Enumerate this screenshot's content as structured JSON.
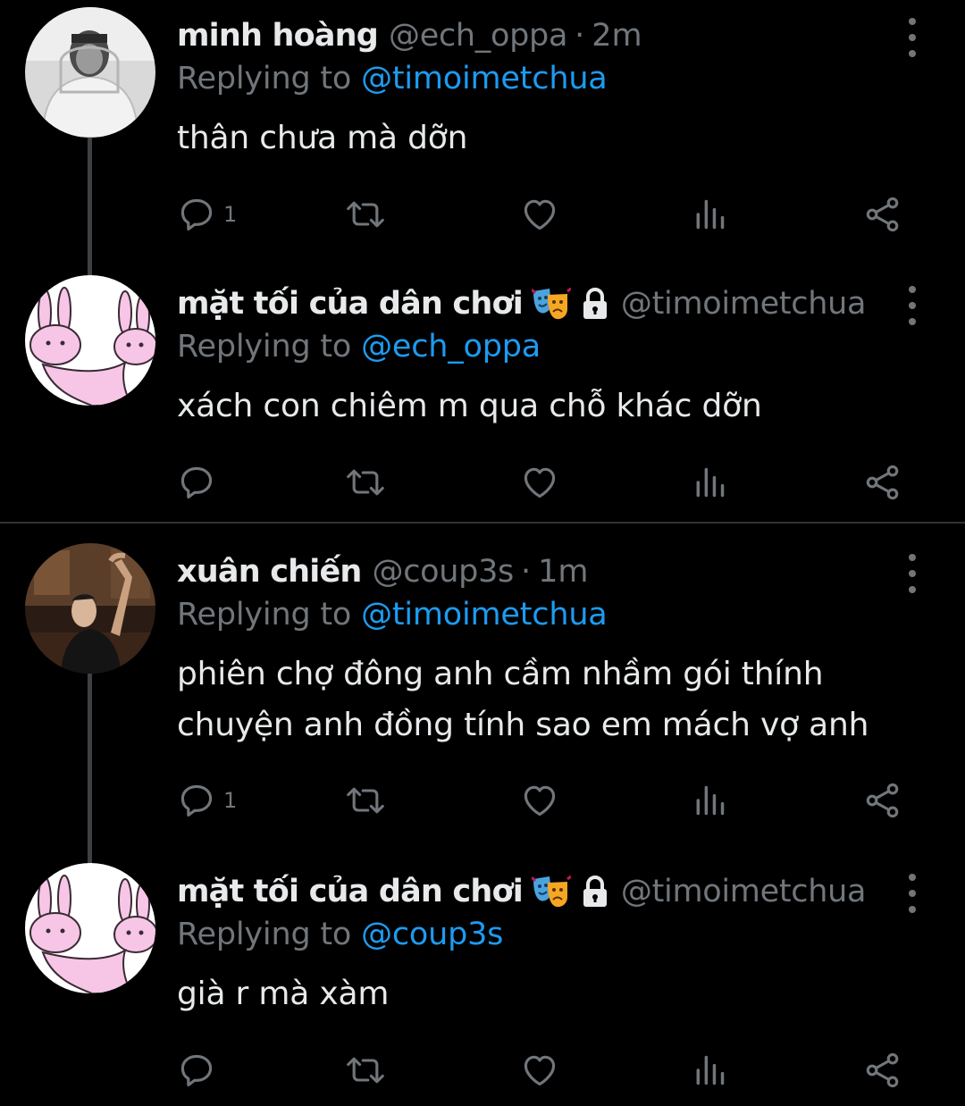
{
  "replying_prefix": "Replying to",
  "tweets": [
    {
      "name": "minh hoàng",
      "handle": "@ech_oppa",
      "separator": "·",
      "time": "2m",
      "reply_to": "@timoimetchua",
      "text": [
        "thân chưa mà dỡn"
      ],
      "reply_count": "1",
      "avatar": "person-in-hoodie"
    },
    {
      "name": "mặt tối của dân chơi",
      "handle": "@timoimetchua",
      "separator": "·",
      "truncation": "...",
      "reply_to": "@ech_oppa",
      "text": [
        "xách con chiêm m qua chỗ khác dỡn"
      ],
      "reply_count": "",
      "avatar": "pink-bunnies"
    },
    {
      "name": "xuân chiến",
      "handle": "@coup3s",
      "separator": "·",
      "time": "1m",
      "reply_to": "@timoimetchua",
      "text": [
        "phiên chợ đông anh cầm nhầm gói thính",
        "chuyện anh đồng tính sao em mách vợ anh"
      ],
      "reply_count": "1",
      "avatar": "person-dark-photo"
    },
    {
      "name": "mặt tối của dân chơi",
      "handle": "@timoimetchua",
      "separator": "·",
      "truncation": "...",
      "reply_to": "@coup3s",
      "text": [
        "già r mà xàm"
      ],
      "reply_count": "",
      "avatar": "pink-bunnies"
    }
  ],
  "colors": {
    "background": "#000000",
    "text_primary": "#e7e9ea",
    "text_secondary": "#71767b",
    "link": "#1d9bf0",
    "thread_line": "#3e4144",
    "divider": "#2f3336"
  },
  "icons": [
    "reply-icon",
    "retweet-icon",
    "like-icon",
    "views-icon",
    "share-icon",
    "more-options-icon",
    "lock-icon",
    "performing-arts-emoji"
  ]
}
